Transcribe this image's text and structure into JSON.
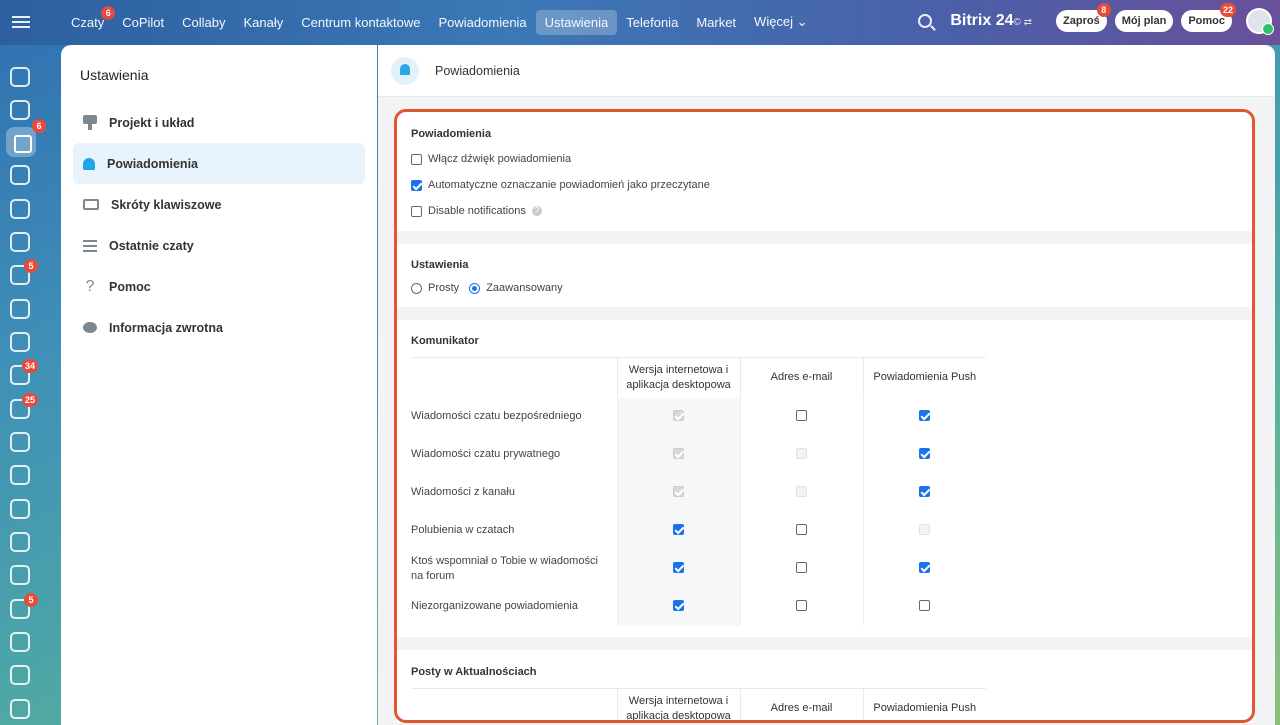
{
  "topbar": {
    "nav": [
      {
        "label": "Czaty",
        "badge": "6"
      },
      {
        "label": "CoPilot"
      },
      {
        "label": "Collaby"
      },
      {
        "label": "Kanały"
      },
      {
        "label": "Centrum kontaktowe"
      },
      {
        "label": "Powiadomienia"
      },
      {
        "label": "Ustawienia",
        "active": true
      },
      {
        "label": "Telefonia"
      },
      {
        "label": "Market"
      },
      {
        "label": "Więcej ⌄"
      }
    ],
    "brand": "Bitrix 24",
    "brand_sub": "© ⇄",
    "invite_label": "Zaproś",
    "invite_badge": "8",
    "plan_label": "Mój plan",
    "help_label": "Pomoc",
    "help_badge": "22"
  },
  "leftbar": {
    "badges": [
      "6",
      "5",
      "34",
      "25",
      "5"
    ]
  },
  "settings_menu": {
    "title": "Ustawienia",
    "items": [
      {
        "label": "Projekt i układ",
        "icon": "brush-icon"
      },
      {
        "label": "Powiadomienia",
        "icon": "bell-icon",
        "active": true
      },
      {
        "label": "Skróty klawiszowe",
        "icon": "keyboard-icon"
      },
      {
        "label": "Ostatnie czaty",
        "icon": "list-icon"
      },
      {
        "label": "Pomoc",
        "icon": "question-icon"
      },
      {
        "label": "Informacja zwrotna",
        "icon": "chat-bubble-icon"
      }
    ]
  },
  "main": {
    "header_title": "Powiadomienia",
    "notifications": {
      "title": "Powiadomienia",
      "options": [
        {
          "label": "Włącz dźwięk powiadomienia",
          "checked": false
        },
        {
          "label": "Automatyczne oznaczanie powiadomień jako przeczytane",
          "checked": true
        },
        {
          "label": "Disable notifications",
          "checked": false,
          "help": "?"
        }
      ]
    },
    "mode": {
      "title": "Ustawienia",
      "options": [
        {
          "label": "Prosty",
          "checked": false
        },
        {
          "label": "Zaawansowany",
          "checked": true
        }
      ]
    },
    "messenger": {
      "title": "Komunikator",
      "columns": [
        "Wersja internetowa i aplikacja desktopowa",
        "Adres e-mail",
        "Powiadomienia Push"
      ],
      "rows": [
        {
          "label": "Wiadomości czatu bezpośredniego",
          "cells": [
            "disabled-checked",
            "unchecked",
            "checked"
          ]
        },
        {
          "label": "Wiadomości czatu prywatnego",
          "cells": [
            "disabled-checked",
            "dim",
            "checked"
          ]
        },
        {
          "label": "Wiadomości z kanału",
          "cells": [
            "disabled-checked",
            "dim",
            "checked"
          ]
        },
        {
          "label": "Polubienia w czatach",
          "cells": [
            "checked",
            "unchecked",
            "dim"
          ]
        },
        {
          "label": "Ktoś wspomniał o Tobie w wiadomości na forum",
          "cells": [
            "checked",
            "unchecked",
            "checked"
          ]
        },
        {
          "label": "Niezorganizowane powiadomienia",
          "cells": [
            "checked",
            "unchecked",
            "unchecked"
          ]
        }
      ]
    },
    "feed": {
      "title": "Posty w Aktualnościach",
      "columns": [
        "Wersja internetowa i aplikacja desktopowa",
        "Adres e-mail",
        "Powiadomienia Push"
      ]
    }
  },
  "colors": {
    "accent": "#1a73e8",
    "highlight": "#e4572e",
    "badge": "#e84b3a",
    "active_menu": "#e7f4fd"
  }
}
